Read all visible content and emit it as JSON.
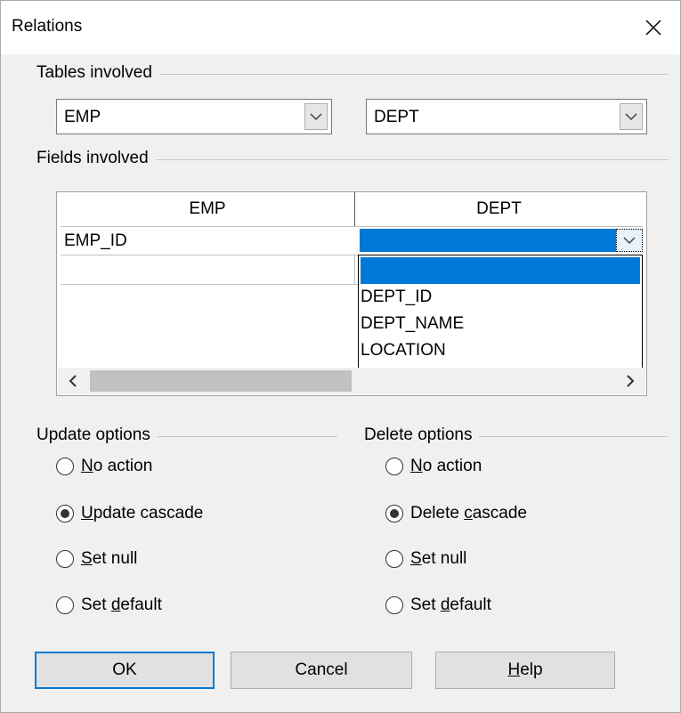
{
  "window": {
    "title": "Relations",
    "close_glyph": "✕"
  },
  "tables_involved": {
    "label": "Tables involved",
    "left_table": "EMP",
    "right_table": "DEPT"
  },
  "fields_involved": {
    "label": "Fields involved",
    "columns": [
      "EMP",
      "DEPT"
    ],
    "rows": [
      {
        "left": "EMP_ID",
        "right": ""
      },
      {
        "left": "",
        "right": ""
      }
    ],
    "dropdown_options": [
      "",
      "DEPT_ID",
      "DEPT_NAME",
      "LOCATION"
    ],
    "dropdown_selected_index": 0
  },
  "update_options": {
    "label": "Update options",
    "options": [
      {
        "pre": "",
        "key": "N",
        "post": "o action",
        "checked": false
      },
      {
        "pre": "",
        "key": "U",
        "post": "pdate cascade",
        "checked": true
      },
      {
        "pre": "",
        "key": "S",
        "post": "et null",
        "checked": false
      },
      {
        "pre": "Set ",
        "key": "d",
        "post": "efault",
        "checked": false
      }
    ]
  },
  "delete_options": {
    "label": "Delete options",
    "options": [
      {
        "pre": "",
        "key": "N",
        "post": "o action",
        "checked": false
      },
      {
        "pre": "Delete ",
        "key": "c",
        "post": "ascade",
        "checked": true
      },
      {
        "pre": "",
        "key": "S",
        "post": "et null",
        "checked": false
      },
      {
        "pre": "Set ",
        "key": "d",
        "post": "efault",
        "checked": false
      }
    ]
  },
  "buttons": {
    "ok": "OK",
    "cancel": "Cancel",
    "help_key": "H",
    "help_rest": "elp"
  },
  "colors": {
    "accent": "#0078d7",
    "dialog_bg": "#f0f0f0"
  },
  "icons": {
    "chevron_down": "chevron-down-icon",
    "close": "close-icon",
    "scroll_left": "chevron-left-icon",
    "scroll_right": "chevron-right-icon"
  }
}
